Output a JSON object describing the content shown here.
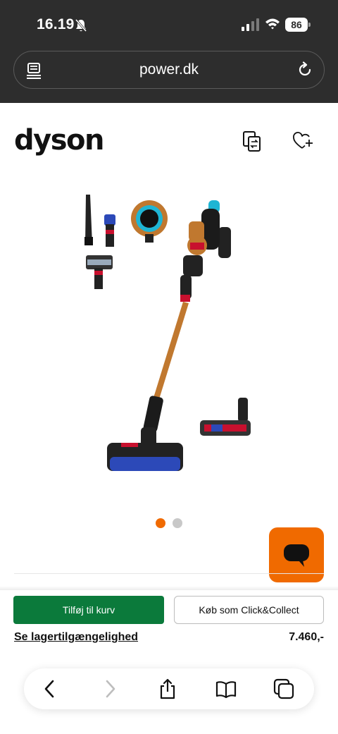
{
  "status_bar": {
    "time": "16.19",
    "battery": "86",
    "icons": [
      "bell-slash-icon",
      "cellular-signal-icon",
      "wifi-icon",
      "battery-icon"
    ]
  },
  "address_bar": {
    "url": "power.dk",
    "left_icon": "reader-icon",
    "right_icon": "reload-icon"
  },
  "header": {
    "brand": "dyson",
    "icons": [
      "compare-icon",
      "wishlist-add-icon"
    ]
  },
  "gallery": {
    "image": "dyson-cordless-vacuum-with-accessories",
    "slide_count": 2,
    "active_slide": 1
  },
  "chat": {
    "icon": "chat-bubble-icon",
    "color": "#f06a00"
  },
  "actions": {
    "add_to_cart": "Tilføj til kurv",
    "click_collect": "Køb som Click&Collect",
    "stock_link": "Se lagertilgængelighed",
    "price": "7.460,-"
  },
  "colors": {
    "accent": "#f06a00",
    "primary_button": "#0b7a3b",
    "top_bar": "#2d2d2d"
  },
  "toolbar": {
    "icons": [
      "back-icon",
      "forward-icon",
      "share-icon",
      "bookmarks-icon",
      "tabs-icon"
    ]
  }
}
